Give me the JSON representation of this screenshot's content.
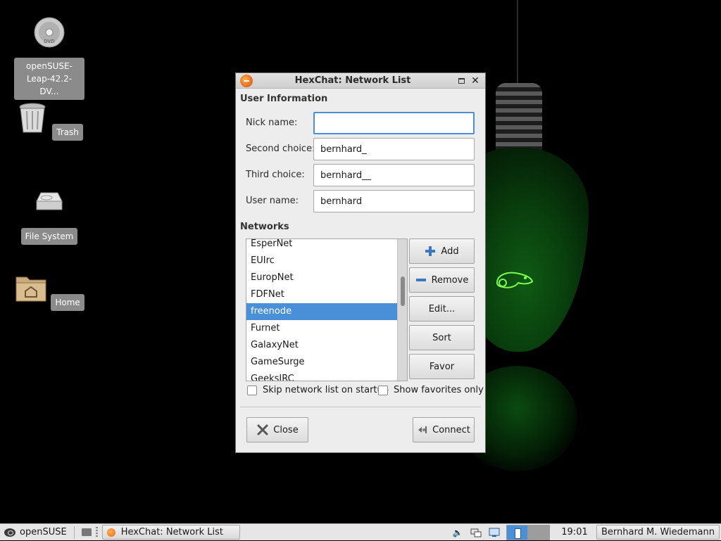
{
  "desktop": {
    "icons": [
      {
        "label": "openSUSE-\nLeap-42.2-DV...",
        "icon": "dvd-icon"
      },
      {
        "label": "Trash",
        "icon": "trash-icon"
      },
      {
        "label": "File System",
        "icon": "harddisk-icon"
      },
      {
        "label": "Home",
        "icon": "home-folder-icon"
      }
    ],
    "label_line1": "openSUSE-",
    "label_line2": "Leap-42.2-DV..."
  },
  "dialog": {
    "title": "HexChat: Network List",
    "user_info_heading": "User Information",
    "fields": {
      "nick": {
        "label": "Nick name:",
        "value": ""
      },
      "second": {
        "label": "Second choice:",
        "value": "bernhard_"
      },
      "third": {
        "label": "Third choice:",
        "value": "bernhard__"
      },
      "user": {
        "label": "User name:",
        "value": "bernhard"
      }
    },
    "networks_heading": "Networks",
    "networks": [
      "EsperNet",
      "EUIrc",
      "EuropNet",
      "FDFNet",
      "freenode",
      "Furnet",
      "GalaxyNet",
      "GameSurge",
      "GeeksIRC"
    ],
    "selected_network": "freenode",
    "buttons": {
      "add": "Add",
      "remove": "Remove",
      "edit": "Edit...",
      "sort": "Sort",
      "favor": "Favor",
      "close": "Close",
      "connect": "Connect"
    },
    "checkboxes": {
      "skip": {
        "label": "Skip network list on startup",
        "checked": false
      },
      "favorites": {
        "label": "Show favorites only",
        "checked": false
      }
    },
    "colors": {
      "selection": "#4a90d9",
      "focus_border": "#4a90d9"
    }
  },
  "taskbar": {
    "start_label": "openSUSE",
    "task_label": "HexChat: Network List",
    "clock": "19:01",
    "user": "Bernhard M. Wiedemann"
  }
}
